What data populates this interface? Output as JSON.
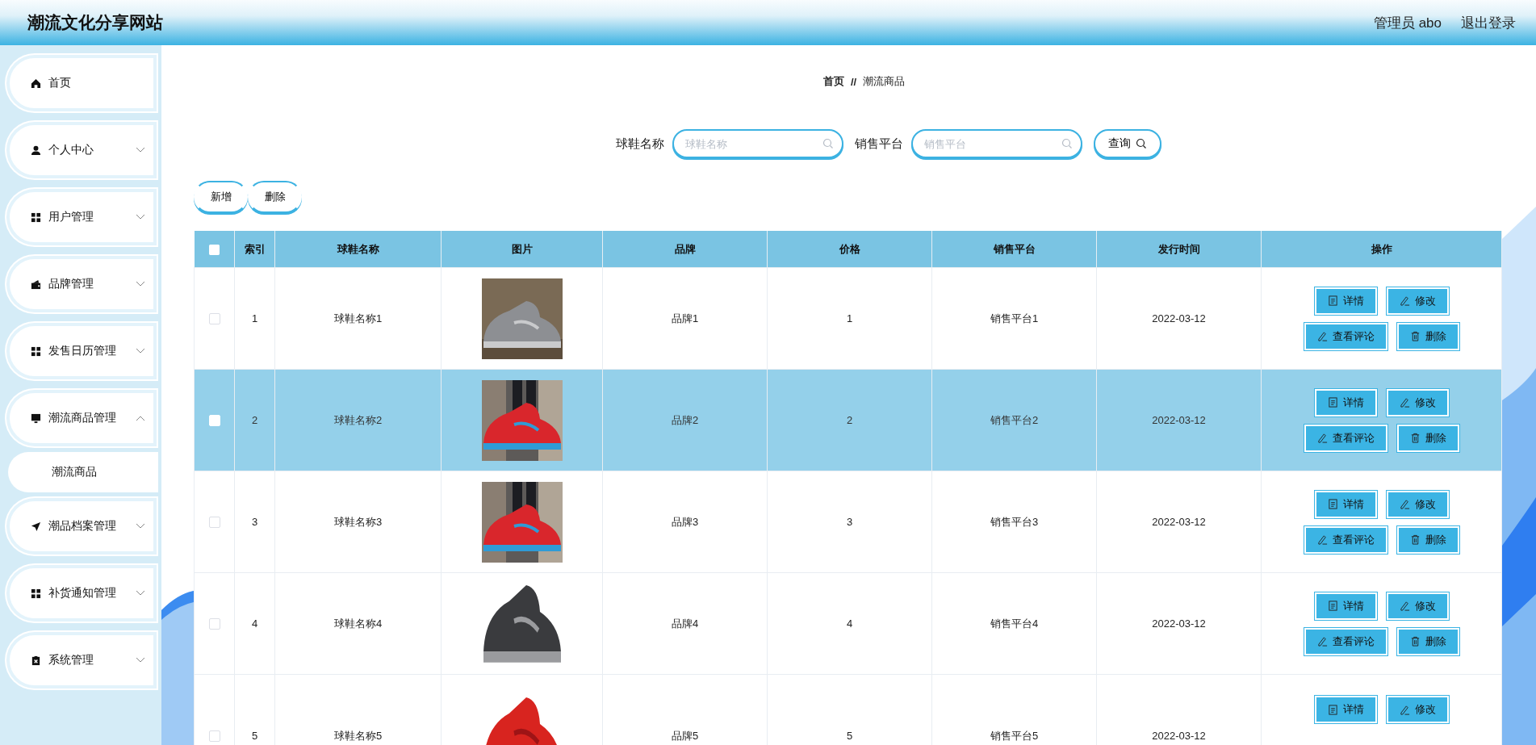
{
  "header": {
    "title": "潮流文化分享网站",
    "user": "管理员 abo",
    "logout": "退出登录"
  },
  "sidebar": {
    "items": [
      {
        "label": "首页",
        "kind": "link"
      },
      {
        "label": "个人中心",
        "kind": "menu",
        "expanded": false
      },
      {
        "label": "用户管理",
        "kind": "menu",
        "expanded": false
      },
      {
        "label": "品牌管理",
        "kind": "menu",
        "expanded": false
      },
      {
        "label": "发售日历管理",
        "kind": "menu",
        "expanded": false
      },
      {
        "label": "潮流商品管理",
        "kind": "menu",
        "expanded": true,
        "children": [
          {
            "label": "潮流商品"
          }
        ]
      },
      {
        "label": "潮品档案管理",
        "kind": "menu",
        "expanded": false
      },
      {
        "label": "补货通知管理",
        "kind": "menu",
        "expanded": false
      },
      {
        "label": "系统管理",
        "kind": "menu",
        "expanded": false
      }
    ]
  },
  "breadcrumb": {
    "home": "首页",
    "separator": "//",
    "current": "潮流商品"
  },
  "search": {
    "fields": [
      {
        "label": "球鞋名称",
        "placeholder": "球鞋名称"
      },
      {
        "label": "销售平台",
        "placeholder": "销售平台"
      }
    ],
    "button": "查询"
  },
  "toolbar": [
    "新增",
    "删除"
  ],
  "table": {
    "select_all": {
      "checked": false
    },
    "columns": [
      "索引",
      "球鞋名称",
      "图片",
      "品牌",
      "价格",
      "销售平台",
      "发行时间",
      "操作"
    ],
    "rows": [
      {
        "selected": false,
        "index": "1",
        "name": "球鞋名称1",
        "brand": "品牌1",
        "price": "1",
        "platform": "销售平台1",
        "date": "2022-03-12",
        "actions": [
          "详情",
          "修改",
          "查看评论",
          "删除"
        ]
      },
      {
        "selected": true,
        "index": "2",
        "name": "球鞋名称2",
        "brand": "品牌2",
        "price": "2",
        "platform": "销售平台2",
        "date": "2022-03-12",
        "actions": [
          "详情",
          "修改",
          "查看评论",
          "删除"
        ]
      },
      {
        "selected": false,
        "index": "3",
        "name": "球鞋名称3",
        "brand": "品牌3",
        "price": "3",
        "platform": "销售平台3",
        "date": "2022-03-12",
        "actions": [
          "详情",
          "修改",
          "查看评论",
          "删除"
        ]
      },
      {
        "selected": false,
        "index": "4",
        "name": "球鞋名称4",
        "brand": "品牌4",
        "price": "4",
        "platform": "销售平台4",
        "date": "2022-03-12",
        "actions": [
          "详情",
          "修改",
          "查看评论",
          "删除"
        ]
      },
      {
        "selected": false,
        "index": "5",
        "name": "球鞋名称5",
        "brand": "品牌5",
        "price": "5",
        "platform": "销售平台5",
        "date": "2022-03-12",
        "actions": [
          "详情",
          "修改"
        ]
      }
    ]
  }
}
